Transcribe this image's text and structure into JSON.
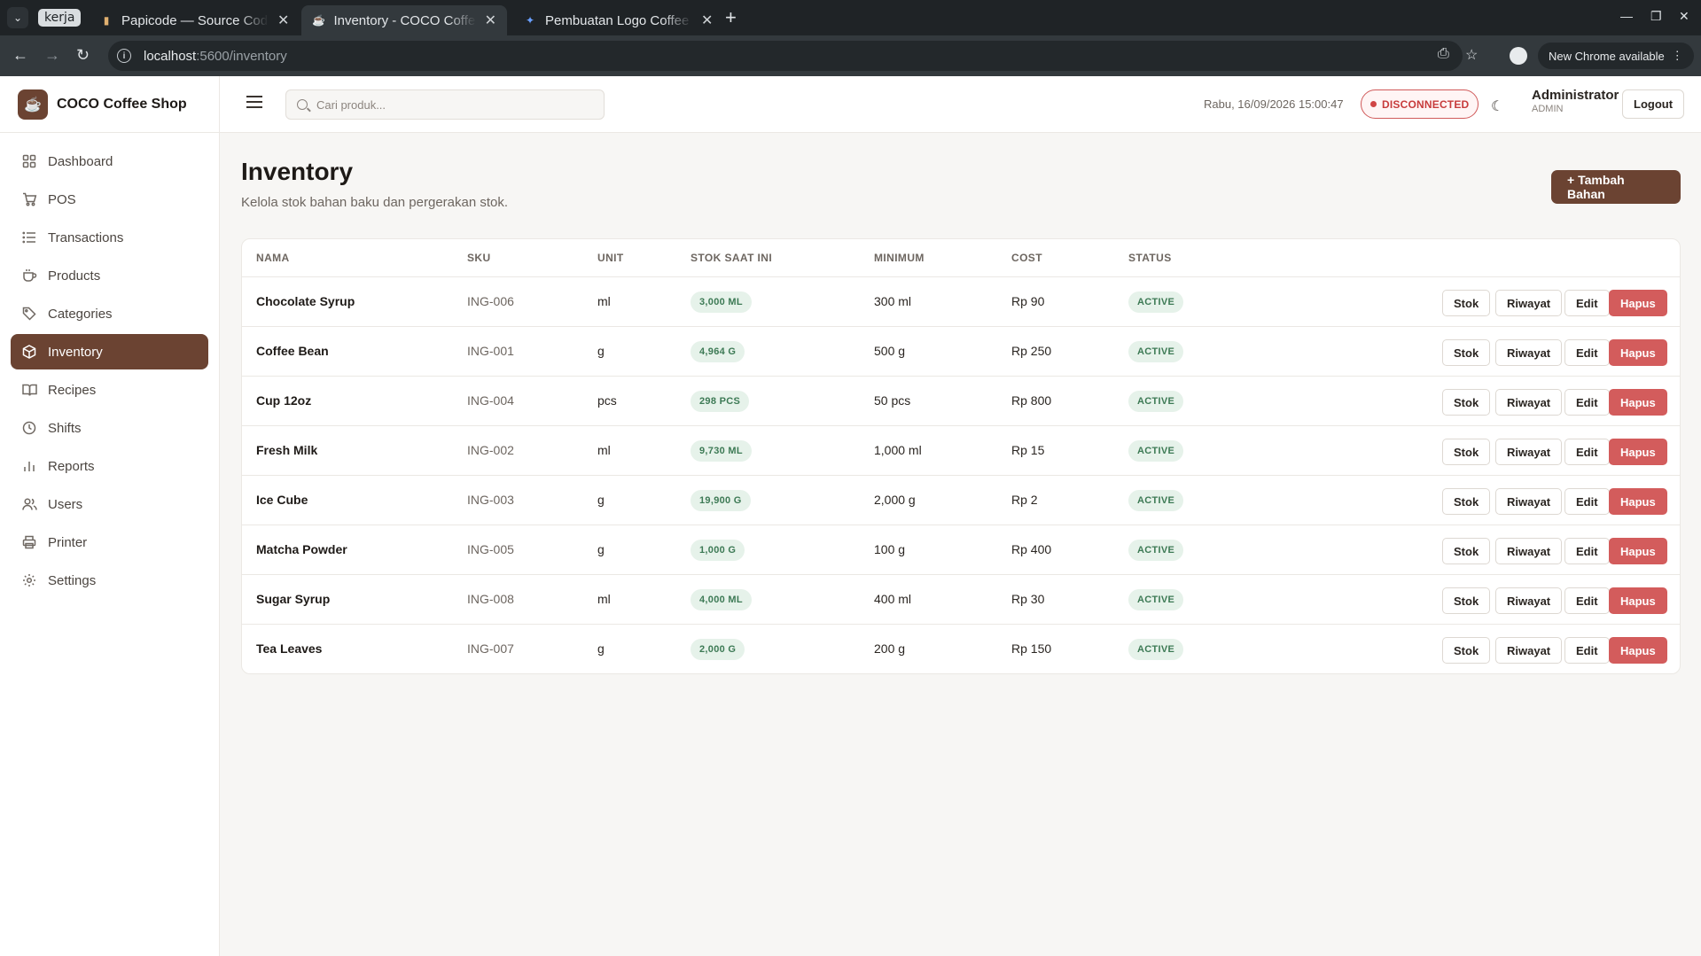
{
  "browser": {
    "tab_group": "kerja",
    "tabs": [
      {
        "title": "Papicode — Source Code",
        "active": false
      },
      {
        "title": "Inventory - COCO Coffee Shop",
        "active": true
      },
      {
        "title": "Pembuatan Logo Coffee Shop",
        "active": false
      }
    ],
    "url_host": "localhost",
    "url_path": ":5600/inventory",
    "update_label": "New Chrome available"
  },
  "app": {
    "brand": "COCO Coffee Shop",
    "nav": [
      {
        "label": "Dashboard",
        "icon": "grid-icon"
      },
      {
        "label": "POS",
        "icon": "cart-icon"
      },
      {
        "label": "Transactions",
        "icon": "list-icon"
      },
      {
        "label": "Products",
        "icon": "cup-icon"
      },
      {
        "label": "Categories",
        "icon": "tag-icon"
      },
      {
        "label": "Inventory",
        "icon": "box-icon",
        "active": true
      },
      {
        "label": "Recipes",
        "icon": "book-icon"
      },
      {
        "label": "Shifts",
        "icon": "clock-icon"
      },
      {
        "label": "Reports",
        "icon": "bar-chart-icon"
      },
      {
        "label": "Users",
        "icon": "users-icon"
      },
      {
        "label": "Printer",
        "icon": "printer-icon"
      },
      {
        "label": "Settings",
        "icon": "gear-icon"
      }
    ]
  },
  "topbar": {
    "search_placeholder": "Cari produk...",
    "datetime": "Rabu, 16/09/2026 15:00:47",
    "connection": "DISCONNECTED",
    "user_name": "Administrator",
    "user_role": "ADMIN",
    "logout": "Logout"
  },
  "page": {
    "title": "Inventory",
    "subtitle": "Kelola stok bahan baku dan pergerakan stok.",
    "add_button": "+ Tambah Bahan"
  },
  "table": {
    "headers": [
      "NAMA",
      "SKU",
      "UNIT",
      "STOK SAAT INI",
      "MINIMUM",
      "COST",
      "STATUS"
    ],
    "actions": {
      "stock": "Stok",
      "history": "Riwayat",
      "edit": "Edit",
      "delete": "Hapus"
    },
    "rows": [
      {
        "name": "Chocolate Syrup",
        "sku": "ING-006",
        "unit": "ml",
        "stock": "3,000 ML",
        "minimum": "300 ml",
        "cost": "Rp 90",
        "status": "ACTIVE"
      },
      {
        "name": "Coffee Bean",
        "sku": "ING-001",
        "unit": "g",
        "stock": "4,964 G",
        "minimum": "500 g",
        "cost": "Rp 250",
        "status": "ACTIVE"
      },
      {
        "name": "Cup 12oz",
        "sku": "ING-004",
        "unit": "pcs",
        "stock": "298 PCS",
        "minimum": "50 pcs",
        "cost": "Rp 800",
        "status": "ACTIVE"
      },
      {
        "name": "Fresh Milk",
        "sku": "ING-002",
        "unit": "ml",
        "stock": "9,730 ML",
        "minimum": "1,000 ml",
        "cost": "Rp 15",
        "status": "ACTIVE"
      },
      {
        "name": "Ice Cube",
        "sku": "ING-003",
        "unit": "g",
        "stock": "19,900 G",
        "minimum": "2,000 g",
        "cost": "Rp 2",
        "status": "ACTIVE"
      },
      {
        "name": "Matcha Powder",
        "sku": "ING-005",
        "unit": "g",
        "stock": "1,000 G",
        "minimum": "100 g",
        "cost": "Rp 400",
        "status": "ACTIVE"
      },
      {
        "name": "Sugar Syrup",
        "sku": "ING-008",
        "unit": "ml",
        "stock": "4,000 ML",
        "minimum": "400 ml",
        "cost": "Rp 30",
        "status": "ACTIVE"
      },
      {
        "name": "Tea Leaves",
        "sku": "ING-007",
        "unit": "g",
        "stock": "2,000 G",
        "minimum": "200 g",
        "cost": "Rp 150",
        "status": "ACTIVE"
      }
    ]
  },
  "colors": {
    "brand": "#6b4332",
    "danger": "#d35c5c",
    "success_pill": "#e6f2ea"
  }
}
